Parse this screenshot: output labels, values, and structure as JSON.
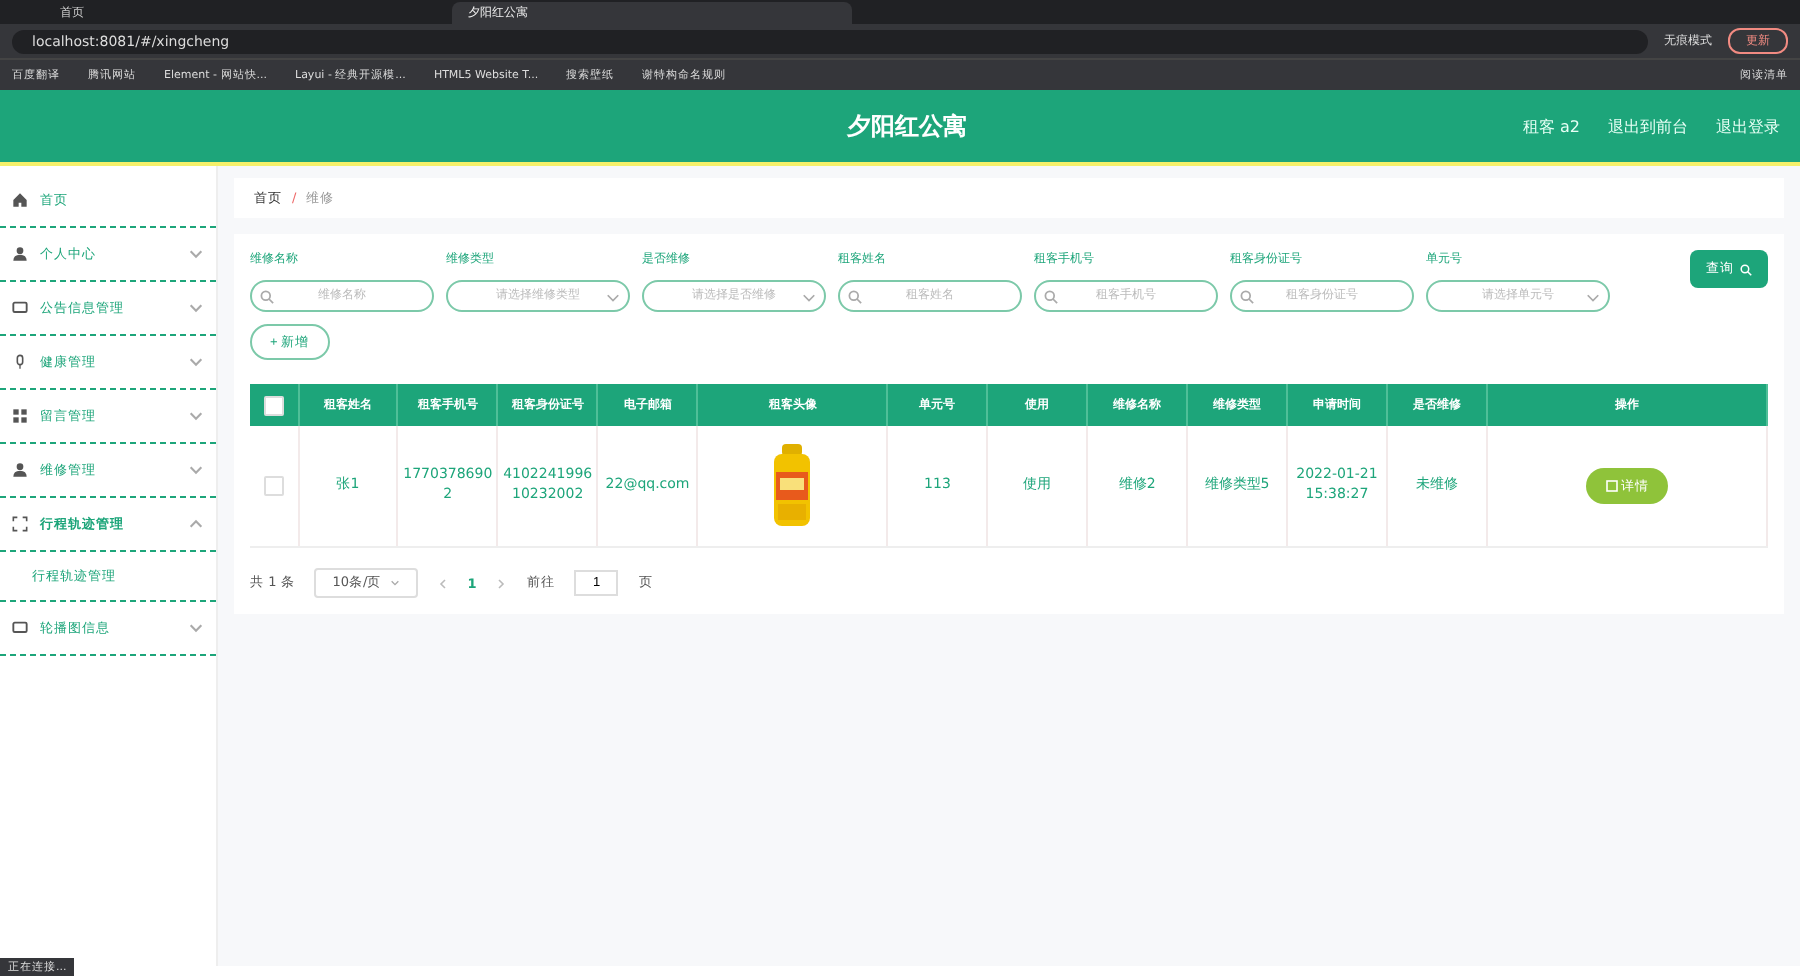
{
  "browser": {
    "tabs": [
      {
        "title": "首页",
        "selected": false
      },
      {
        "title": "夕阳红公寓",
        "selected": true
      }
    ],
    "url": "localhost:8081/#/xingcheng",
    "bookmarks": [
      "百度翻译",
      "腾讯网站",
      "Element - 网站快...",
      "Layui - 经典开源模...",
      "HTML5 Website T...",
      "搜索壁纸",
      "谢特构命名规则"
    ],
    "profile": "无痕模式",
    "update": "更新",
    "reading_list": "阅读清单"
  },
  "header": {
    "title": "夕阳红公寓",
    "user": "租客 a2",
    "links": [
      "退出到前台",
      "退出登录"
    ]
  },
  "sidebar": {
    "items": [
      {
        "label": "首页",
        "kind": "link"
      },
      {
        "label": "个人中心",
        "kind": "group",
        "expanded": false
      },
      {
        "label": "公告信息管理",
        "kind": "group",
        "expanded": false
      },
      {
        "label": "健康管理",
        "kind": "group",
        "expanded": false
      },
      {
        "label": "留言管理",
        "kind": "group",
        "expanded": false
      },
      {
        "label": "维修管理",
        "kind": "group",
        "expanded": false
      },
      {
        "label": "行程轨迹管理",
        "kind": "group",
        "expanded": true,
        "children": [
          {
            "label": "行程轨迹管理"
          }
        ]
      },
      {
        "label": "轮播图信息",
        "kind": "group",
        "expanded": false
      }
    ]
  },
  "breadcrumb": [
    "首页",
    "维修"
  ],
  "breadcrumb_separator": "/",
  "filters": [
    {
      "label": "维修名称",
      "placeholder": "维修名称",
      "kind": "search"
    },
    {
      "label": "维修类型",
      "placeholder": "请选择维修类型",
      "kind": "select"
    },
    {
      "label": "是否维修",
      "placeholder": "请选择是否维修",
      "kind": "select"
    },
    {
      "label": "租客姓名",
      "placeholder": "租客姓名",
      "kind": "search"
    },
    {
      "label": "租客手机号",
      "placeholder": "租客手机号",
      "kind": "search"
    },
    {
      "label": "租客身份证号",
      "placeholder": "租客身份证号",
      "kind": "search"
    },
    {
      "label": "单元号",
      "placeholder": "请选择单元号",
      "kind": "select"
    }
  ],
  "query_button": "查询",
  "add_button": "+ 新增",
  "table": {
    "all_checked": false,
    "columns": [
      "租客姓名",
      "租客手机号",
      "租客身份证号",
      "电子邮箱",
      "租客头像",
      "单元号",
      "使用",
      "维修名称",
      "维修类型",
      "申请时间",
      "是否维修",
      "操作"
    ],
    "rows": [
      {
        "checked": false,
        "cells": [
          "张1",
          "17703786902",
          "410224199610232002",
          "22@qq.com",
          {
            "kind": "picture"
          },
          "113",
          "使用",
          "维修2",
          "维修类型5",
          "2022-01-21 15:38:27",
          "未维修"
        ],
        "action": "详情"
      }
    ]
  },
  "pagination": {
    "total": "共 1 条",
    "page_size": "10条/页",
    "pages": [
      {
        "label": "1",
        "selected": true
      }
    ],
    "goto_label": "前往",
    "goto_value": "1",
    "goto_suffix": "页"
  },
  "status_bar": "正在连接..."
}
